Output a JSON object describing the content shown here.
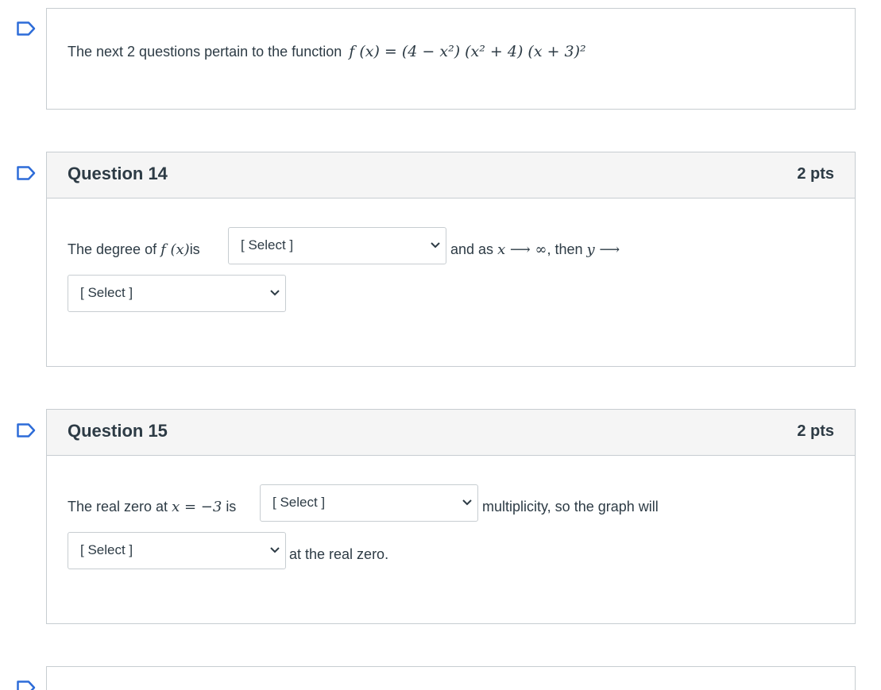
{
  "intro": {
    "text": "The next 2 questions pertain to the function",
    "formula": "f (x) = (4 − x²) (x² + 4) (x + 3)²"
  },
  "q14": {
    "title": "Question 14",
    "points": "2 pts",
    "text_before": "The  degree of",
    "func": "f (x)",
    "text_is": "is",
    "select1": "[ Select ]",
    "text_mid": "and as",
    "limit": "x ⟶ ∞",
    "text_then": ", then",
    "y_arrow": "y ⟶",
    "select2": "[ Select ]"
  },
  "q15": {
    "title": "Question 15",
    "points": "2 pts",
    "text_before": "The real zero at",
    "zero": "x = −3",
    "text_is": "is",
    "select1": "[ Select ]",
    "text_after1": "multiplicity, so the graph will",
    "select2": "[ Select ]",
    "text_after2": "at the real zero."
  },
  "icons": {
    "flag": "bookmark-flag-icon",
    "chevron": "chevron-down-icon"
  },
  "colors": {
    "flag": "#2d6cd8",
    "border": "#c7cdd1",
    "header_bg": "#f5f5f5",
    "text": "#2d3b45"
  }
}
